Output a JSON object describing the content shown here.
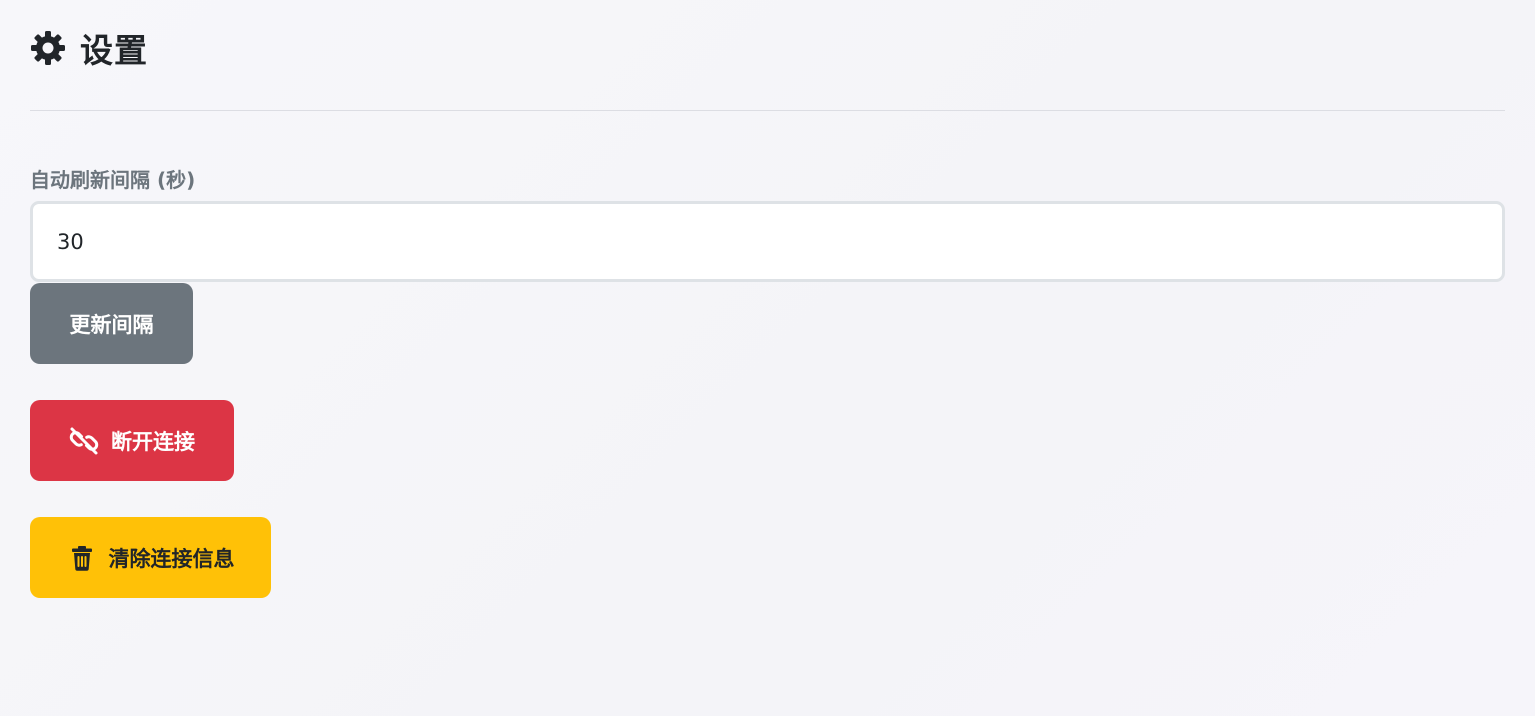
{
  "header": {
    "icon": "gear-icon",
    "title": "设置"
  },
  "settings": {
    "interval_label": "自动刷新间隔 (秒)",
    "interval_value": "30",
    "update_button_label": "更新间隔"
  },
  "actions": {
    "disconnect": {
      "icon": "unlink-icon",
      "label": "断开连接",
      "color": "#dc3545"
    },
    "clear": {
      "icon": "trash-icon",
      "label": "清除连接信息",
      "color": "#ffc107"
    }
  },
  "colors": {
    "secondary": "#6c757d",
    "danger": "#dc3545",
    "warning": "#ffc107"
  }
}
